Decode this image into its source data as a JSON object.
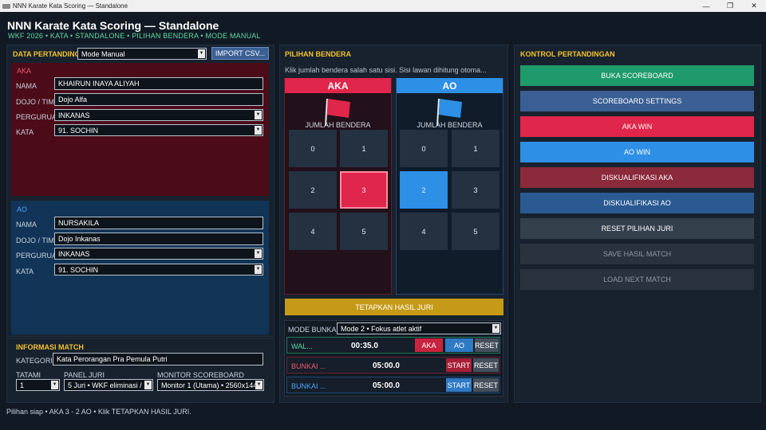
{
  "window": {
    "title": "NNN Karate Kata Scoring — Standalone",
    "minimize": "—",
    "maximize": "❐",
    "close": "✕"
  },
  "header": {
    "title": "NNN Karate Kata Scoring — Standalone",
    "subtitle": "WKF 2026 • KATA • STANDALONE • PILIHAN BENDERA • MODE MANUAL"
  },
  "data_pertandingan": {
    "title": "DATA PERTANDINGAN",
    "mode_value": "Mode Manual",
    "import_label": "IMPORT CSV...",
    "aka": {
      "title": "AKA",
      "nama_label": "NAMA",
      "nama_value": "KHAIRUN INAYA ALIYAH",
      "dojo_label": "DOJO / TIM",
      "dojo_value": "Dojo Alfa",
      "perguruan_label": "PERGURUAN",
      "perguruan_value": "INKANAS",
      "kata_label": "KATA",
      "kata_value": "91. SOCHIN"
    },
    "ao": {
      "title": "AO",
      "nama_label": "NAMA",
      "nama_value": "NURSAKILA",
      "dojo_label": "DOJO / TIM",
      "dojo_value": "Dojo Inkanas",
      "perguruan_label": "PERGURUAN",
      "perguruan_value": "INKANAS",
      "kata_label": "KATA",
      "kata_value": "91. SOCHIN"
    }
  },
  "informasi_match": {
    "title": "INFORMASI MATCH",
    "kategori_label": "KATEGORI",
    "kategori_value": "Kata Perorangan Pra Pemula Putri",
    "tatami_label": "TATAMI",
    "tatami_value": "1",
    "panel_label": "PANEL JURI",
    "panel_value": "5 Juri • WKF eliminasi / ...",
    "monitor_label": "MONITOR SCOREBOARD",
    "monitor_value": "Monitor 1 (Utama) • 2560x1440"
  },
  "pilihan_bendera": {
    "title": "PILIHAN BENDERA",
    "hint": "Klik jumlah bendera salah satu sisi. Sisi lawan dihitung otoma...",
    "aka": {
      "title": "AKA",
      "jumlah_label": "JUMLAH BENDERA",
      "options": [
        "0",
        "1",
        "2",
        "3",
        "4",
        "5"
      ],
      "selected": "3"
    },
    "ao": {
      "title": "AO",
      "jumlah_label": "JUMLAH BENDERA",
      "options": [
        "0",
        "1",
        "2",
        "3",
        "4",
        "5"
      ],
      "selected": "2"
    },
    "tetapkan_label": "TETAPKAN HASIL JURI",
    "mode_bunkai_label": "MODE BUNKAI",
    "mode_bunkai_value": "Mode 2 • Fokus atlet aktif",
    "timers": [
      {
        "label": "WAL...",
        "time": "00:35.0",
        "btn1": "AKA",
        "btn2": "AO",
        "btn3": "RESET"
      },
      {
        "label": "BUNKAI ...",
        "time": "05:00.0",
        "btn1": "START",
        "btn3": "RESET"
      },
      {
        "label": "BUNKAI ...",
        "time": "05:00.0",
        "btn1": "START",
        "btn3": "RESET"
      }
    ]
  },
  "kontrol": {
    "title": "KONTROL PERTANDINGAN",
    "buttons": [
      {
        "label": "BUKA SCOREBOARD",
        "color": "#1f9a6a"
      },
      {
        "label": "SCOREBOARD SETTINGS",
        "color": "#3a5f93"
      },
      {
        "label": "AKA WIN",
        "color": "#e0264a"
      },
      {
        "label": "AO WIN",
        "color": "#2e8fe6"
      },
      {
        "label": "DISKUALIFIKASI AKA",
        "color": "#8a2a3b"
      },
      {
        "label": "DISKUALIFIKASI AO",
        "color": "#2a5a91"
      },
      {
        "label": "RESET PILIHAN JURI",
        "color": "#35404d"
      },
      {
        "label": "SAVE HASIL MATCH",
        "color": "#2a333d"
      },
      {
        "label": "LOAD NEXT MATCH",
        "color": "#2a333d"
      }
    ]
  },
  "status_text": "Pilihan siap • AKA 3 - 2 AO • Klik TETAPKAN HASIL JURI.",
  "colors": {
    "aka": "#e0264a",
    "ao": "#2e8fe6",
    "accent": "#f2c12e",
    "gold_button": "#c49a17"
  }
}
